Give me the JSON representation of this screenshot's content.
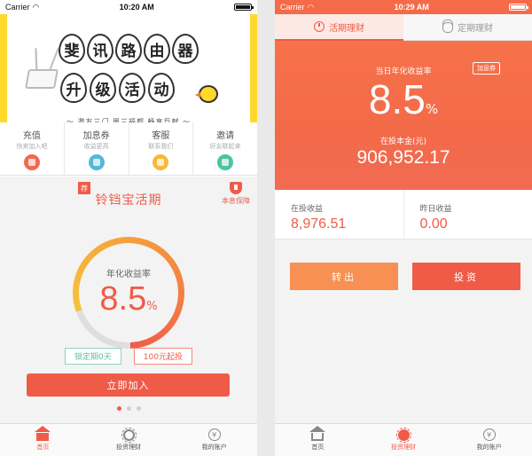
{
  "left": {
    "status": {
      "carrier": "Carrier",
      "time": "10:20 AM"
    },
    "banner": {
      "row1": [
        "斐",
        "讯",
        "路",
        "由",
        "器"
      ],
      "row2": [
        "升",
        "级",
        "活",
        "动"
      ],
      "tagline": "～ 邀友三门  周三福都  畅享巨献 ～"
    },
    "quick_menu": [
      {
        "title": "充值",
        "sub": "快来加入吧"
      },
      {
        "title": "加息券",
        "sub": "收益更高"
      },
      {
        "title": "客服",
        "sub": "联系我们"
      },
      {
        "title": "邀请",
        "sub": "好友联起来"
      }
    ],
    "product": {
      "badge": "荐",
      "name": "铃铛宝活期",
      "guarantee": "本息保障",
      "rate_label": "年化收益率",
      "rate_value": "8.5",
      "rate_unit": "%",
      "tag_lock": "锁定期0天",
      "tag_min": "100元起投",
      "join_label": "立即加入",
      "ring_progress": 0.8
    },
    "tabs": [
      {
        "label": "首页",
        "icon": "home-icon",
        "active": true
      },
      {
        "label": "投资理财",
        "icon": "sun-icon",
        "active": false
      },
      {
        "label": "我的账户",
        "icon": "yen-icon",
        "active": false
      }
    ]
  },
  "right": {
    "status": {
      "carrier": "Carrier",
      "time": "10:29 AM"
    },
    "segments": [
      {
        "label": "活期理财",
        "icon": "clock-icon",
        "active": true
      },
      {
        "label": "定期理财",
        "icon": "coins-icon",
        "active": false
      }
    ],
    "hero": {
      "rate_label": "当日年化收益率",
      "coupon": "加息券",
      "rate_value": "8.5",
      "rate_unit": "%",
      "principal_label": "在投本金(元)",
      "principal": "906,952.17"
    },
    "stats": [
      {
        "label": "在投收益",
        "value": "8,976.51"
      },
      {
        "label": "昨日收益",
        "value": "0.00"
      }
    ],
    "actions": {
      "out_label": "转出",
      "invest_label": "投资"
    },
    "tabs": [
      {
        "label": "首页",
        "icon": "home-icon",
        "active": false
      },
      {
        "label": "投资理财",
        "icon": "sun-icon",
        "active": true
      },
      {
        "label": "我的账户",
        "icon": "yen-icon",
        "active": false
      }
    ]
  },
  "colors": {
    "accent": "#f05b48",
    "orange": "#f79052",
    "banner_yellow": "#ffd92a"
  }
}
